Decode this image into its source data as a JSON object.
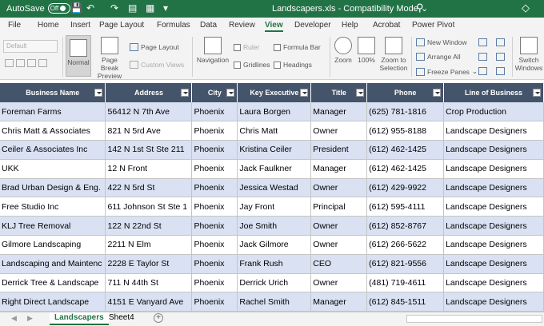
{
  "titlebar": {
    "autosave_label": "AutoSave",
    "autosave_state": "Off",
    "filename": "Landscapers.xls",
    "sep": "-",
    "mode": "Compatibility Mode",
    "mode_arrow": "⌄"
  },
  "menu_tabs": [
    "File",
    "Home",
    "Insert",
    "Page Layout",
    "Formulas",
    "Data",
    "Review",
    "View",
    "Developer",
    "Help",
    "Acrobat",
    "Power Pivot"
  ],
  "active_tab": "View",
  "ribbon": {
    "sheet_view_dropdown": "Default",
    "normal": "Normal",
    "page_break_1": "Page Break",
    "page_break_2": "Preview",
    "page_layout": "Page Layout",
    "custom_views": "Custom Views",
    "navigation": "Navigation",
    "ruler": "Ruler",
    "formula_bar": "Formula Bar",
    "gridlines": "Gridlines",
    "headings": "Headings",
    "zoom": "Zoom",
    "zoom_100": "100%",
    "zoom_sel_1": "Zoom to",
    "zoom_sel_2": "Selection",
    "new_window": "New Window",
    "arrange_all": "Arrange All",
    "freeze_panes": "Freeze Panes",
    "switch_1": "Switch",
    "switch_2": "Windows"
  },
  "table": {
    "headers": [
      "Business Name",
      "Address",
      "City",
      "Key Executive",
      "Title",
      "Phone",
      "Line of Business"
    ],
    "rows": [
      [
        "Foreman Farms",
        "56412 N 7th Ave",
        "Phoenix",
        "Laura Borgen",
        "Manager",
        "(625) 781-1816",
        "Crop Production"
      ],
      [
        "Chris Matt & Associates",
        "821 N 5rd Ave",
        "Phoenix",
        "Chris Matt",
        "Owner",
        "(612) 955-8188",
        "Landscape Designers"
      ],
      [
        "Ceiler & Associates Inc",
        "142 N 1st St Ste 211",
        "Phoenix",
        "Kristina Ceiler",
        "President",
        "(612) 462-1425",
        "Landscape Designers"
      ],
      [
        "UKK",
        "12 N Front",
        "Phoenix",
        "Jack Faulkner",
        "Manager",
        "(612) 462-1425",
        "Landscape Designers"
      ],
      [
        "Brad Urban Design & Eng.",
        "422 N 5rd St",
        "Phoenix",
        "Jessica Westad",
        "Owner",
        "(612) 429-9922",
        "Landscape Designers"
      ],
      [
        "Free Studio Inc",
        "611 Johnson St Ste 1",
        "Phoenix",
        "Jay Front",
        "Principal",
        "(612) 595-4111",
        "Landscape Designers"
      ],
      [
        "KLJ Tree Removal",
        "122 N 22nd St",
        "Phoenix",
        "Joe Smith",
        "Owner",
        "(612) 852-8767",
        "Landscape Designers"
      ],
      [
        "Gilmore Landscaping",
        "2211 N Elm",
        "Phoenix",
        "Jack Gilmore",
        "Owner",
        "(612) 266-5622",
        "Landscape Designers"
      ],
      [
        "Landscaping and Maintenc",
        "2228 E Taylor St",
        "Phoenix",
        "Frank Rush",
        "CEO",
        "(612) 821-9556",
        "Landscape Designers"
      ],
      [
        "Derrick Tree & Landscape",
        "711 N 44th St",
        "Phoenix",
        "Derrick Urich",
        "Owner",
        "(481) 719-4611",
        "Landscape Designers"
      ],
      [
        "Right Direct Landscape",
        "4151 E Vanyard Ave",
        "Phoenix",
        "Rachel Smith",
        "Manager",
        "(612) 845-1511",
        "Landscape Designers"
      ]
    ]
  },
  "sheets": [
    "Landscapers",
    "Sheet4"
  ],
  "active_sheet": "Landscapers",
  "colors": {
    "excel_green": "#217346",
    "header_bg": "#44546a",
    "band": "#d9e1f2"
  }
}
